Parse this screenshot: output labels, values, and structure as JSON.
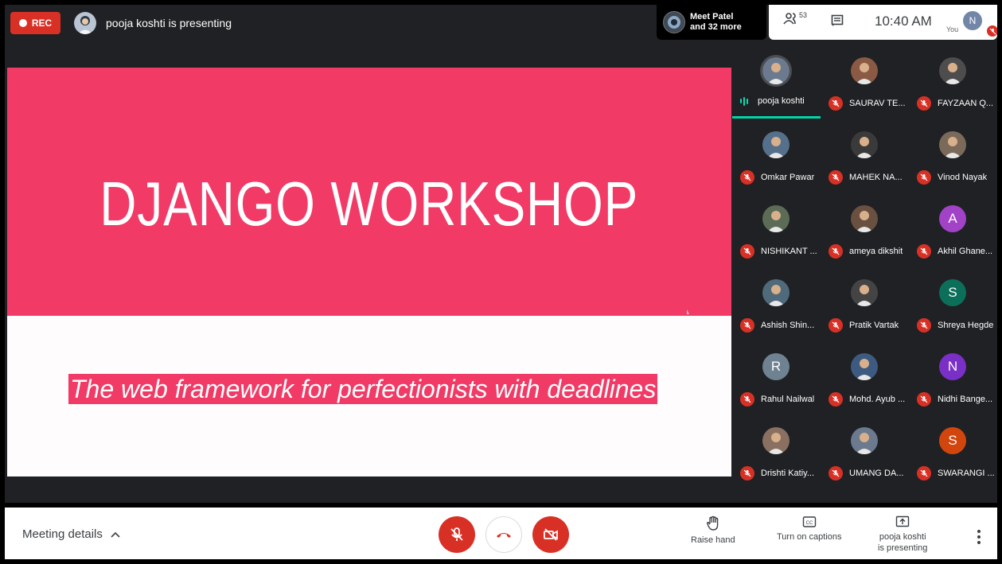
{
  "top": {
    "rec_label": "REC",
    "presenter_text": "pooja koshti is presenting",
    "meet_name": "Meet Patel",
    "meet_more": "and 32 more",
    "people_count": "53",
    "time": "10:40 AM",
    "you_label": "You",
    "self_initial": "N"
  },
  "slide": {
    "title": "DJANGO WORKSHOP",
    "tagline": "The web framework for perfectionists with deadlines",
    "colors": {
      "accent": "#f13a65",
      "background": "#fefcfd"
    }
  },
  "participants": [
    {
      "name": "pooja koshti",
      "type": "photo",
      "speaking": true
    },
    {
      "name": "SAURAV TE...",
      "type": "photo"
    },
    {
      "name": "FAYZAAN Q...",
      "type": "photo"
    },
    {
      "name": "Omkar Pawar",
      "type": "photo"
    },
    {
      "name": "MAHEK NA...",
      "type": "photo"
    },
    {
      "name": "Vinod Nayak",
      "type": "photo"
    },
    {
      "name": "NISHIKANT ...",
      "type": "photo"
    },
    {
      "name": "ameya dikshit",
      "type": "photo"
    },
    {
      "name": "Akhil Ghane...",
      "type": "initial",
      "initial": "A",
      "color": "#a142c7"
    },
    {
      "name": "Ashish Shin...",
      "type": "photo"
    },
    {
      "name": "Pratik Vartak",
      "type": "photo"
    },
    {
      "name": "Shreya Hegde",
      "type": "initial",
      "initial": "S",
      "color": "#0b6f5a"
    },
    {
      "name": "Rahul Nailwal",
      "type": "initial",
      "initial": "R",
      "color": "#6f8291"
    },
    {
      "name": "Mohd. Ayub ...",
      "type": "photo"
    },
    {
      "name": "Nidhi Bange...",
      "type": "initial",
      "initial": "N",
      "color": "#7a2fc7"
    },
    {
      "name": "Drishti Katiy...",
      "type": "photo"
    },
    {
      "name": "UMANG DA...",
      "type": "photo"
    },
    {
      "name": "SWARANGI ...",
      "type": "initial",
      "initial": "S",
      "color": "#d2460d"
    }
  ],
  "bottom": {
    "meeting_details": "Meeting details",
    "raise_hand": "Raise hand",
    "captions": "Turn on captions",
    "presenting_line1": "pooja koshti",
    "presenting_line2": "is presenting"
  }
}
